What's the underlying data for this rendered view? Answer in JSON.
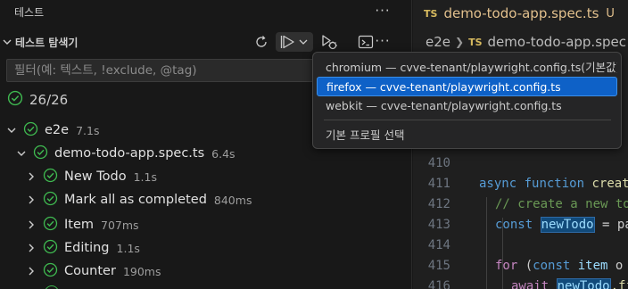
{
  "explorer": {
    "panel_title": "테스트",
    "section_title": "테스트 탐색기",
    "filter_placeholder": "필터(예: 텍스트, !exclude, @tag)",
    "summary_count": "26/26",
    "tree": [
      {
        "label": "e2e",
        "duration": "7.1s",
        "expanded": true
      },
      {
        "label": "demo-todo-app.spec.ts",
        "duration": "6.4s",
        "expanded": true
      },
      {
        "label": "New Todo",
        "duration": "1.1s"
      },
      {
        "label": "Mark all as completed",
        "duration": "840ms"
      },
      {
        "label": "Item",
        "duration": "707ms"
      },
      {
        "label": "Editing",
        "duration": "1.1s"
      },
      {
        "label": "Counter",
        "duration": "190ms"
      }
    ]
  },
  "editor": {
    "tab": {
      "badge": "TS",
      "title": "demo-todo-app.spec.ts",
      "status": "U"
    },
    "breadcrumb": {
      "folder": "e2e",
      "badge": "TS",
      "file": "demo-todo-app.spec"
    },
    "line_numbers": [
      "410",
      "411",
      "412",
      "413",
      "414",
      "415",
      "416"
    ],
    "code": {
      "closing": "});",
      "l411_kw": "async",
      "l411_kw2": "function",
      "l411_fn": "creat",
      "l412_comment": "// create a new to",
      "l413_kw": "const",
      "l413_var": "newTodo",
      "l413_rest": " = pa",
      "l415_kw": "for",
      "l415_rest": " (",
      "l415_kw2": "const",
      "l415_var": "item",
      "l415_rest2": " o",
      "l416_kw": "await",
      "l416_var": "newTodo",
      "l416_rest": ".fi"
    }
  },
  "menu": {
    "items": [
      {
        "label": "chromium — cvve-tenant/playwright.config.ts(기본값)",
        "selected": false
      },
      {
        "label": "firefox — cvve-tenant/playwright.config.ts",
        "selected": true
      },
      {
        "label": "webkit — cvve-tenant/playwright.config.ts",
        "selected": false
      },
      {
        "label": "기본 프로필 선택",
        "selected": false
      }
    ]
  },
  "colors": {
    "pass": "#3fb950",
    "accent": "#0e61c7",
    "ts_badge": "#d7ba5f",
    "modified": "#e2c08d"
  },
  "icons": [
    "ellipsis-icon",
    "chevron-down-icon",
    "refresh-icon",
    "run-tests-icon",
    "debug-tests-icon",
    "terminal-icon",
    "pass-check-icon",
    "chevron-right-icon",
    "ts-file-icon"
  ]
}
